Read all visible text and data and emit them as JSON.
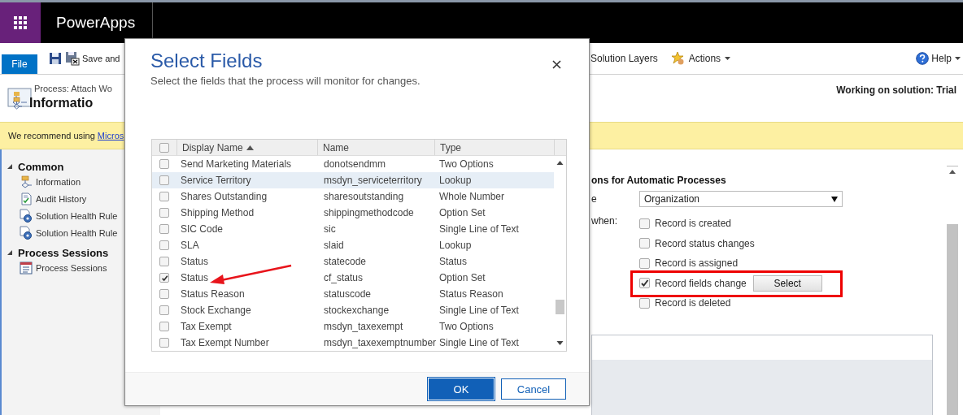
{
  "top_bar": {
    "app_name": "PowerApps"
  },
  "command_bar": {
    "file_tab": "File",
    "left_commands": [
      {
        "kind": "save"
      },
      {
        "kind": "save_close",
        "label": "Save and"
      }
    ],
    "right_commands": [
      {
        "kind": "plain",
        "label": "Solution Layers"
      },
      {
        "kind": "actions",
        "label": "Actions",
        "dropdown": true
      }
    ],
    "help": {
      "label": "Help",
      "dropdown": true
    }
  },
  "header": {
    "subtitle": "Process: Attach Wo",
    "title": "Informatio",
    "solution": "Working on solution: Trial"
  },
  "notice": {
    "text": "We recommend using ",
    "link": "Micros"
  },
  "nav": [
    {
      "label": "Common",
      "expanded": true,
      "items": [
        {
          "kind": "process",
          "label": "Information"
        },
        {
          "kind": "audit",
          "label": "Audit History"
        },
        {
          "kind": "rule",
          "label": "Solution Health Rule"
        },
        {
          "kind": "rule",
          "label": "Solution Health Rule"
        }
      ]
    },
    {
      "label": "Process Sessions",
      "expanded": true,
      "items": [
        {
          "kind": "sessions",
          "label": "Process Sessions"
        }
      ]
    }
  ],
  "automatic": {
    "heading": "ons for Automatic Processes",
    "scope_label": "e",
    "scope_value": "Organization",
    "start_label": "when:",
    "triggers": [
      {
        "label": "Record is created",
        "checked": false,
        "highlighted": false
      },
      {
        "label": "Record status changes",
        "checked": false,
        "highlighted": false
      },
      {
        "label": "Record is assigned",
        "checked": false,
        "highlighted": false
      },
      {
        "label": "Record fields change",
        "checked": true,
        "highlighted": true,
        "button": "Select"
      },
      {
        "label": "Record is deleted",
        "checked": false,
        "highlighted": false
      }
    ]
  },
  "dialog": {
    "title": "Select Fields",
    "subtitle": "Select the fields that the process will monitor for changes.",
    "all_checked": false,
    "columns": [
      {
        "label": "Display Name",
        "sorted_ascending": true
      },
      {
        "label": "Name"
      },
      {
        "label": "Type"
      }
    ],
    "rows": [
      {
        "display_name": "Send Marketing Materials",
        "name": "donotsendmm",
        "type": "Two Options",
        "checked": false,
        "selected": false
      },
      {
        "display_name": "Service Territory",
        "name": "msdyn_serviceterritory",
        "type": "Lookup",
        "checked": false,
        "selected": true
      },
      {
        "display_name": "Shares Outstanding",
        "name": "sharesoutstanding",
        "type": "Whole Number",
        "checked": false,
        "selected": false
      },
      {
        "display_name": "Shipping Method",
        "name": "shippingmethodcode",
        "type": "Option Set",
        "checked": false,
        "selected": false
      },
      {
        "display_name": "SIC Code",
        "name": "sic",
        "type": "Single Line of Text",
        "checked": false,
        "selected": false
      },
      {
        "display_name": "SLA",
        "name": "slaid",
        "type": "Lookup",
        "checked": false,
        "selected": false
      },
      {
        "display_name": "Status",
        "name": "statecode",
        "type": "Status",
        "checked": false,
        "selected": false
      },
      {
        "display_name": "Status",
        "name": "cf_status",
        "type": "Option Set",
        "checked": true,
        "selected": false
      },
      {
        "display_name": "Status Reason",
        "name": "statuscode",
        "type": "Status Reason",
        "checked": false,
        "selected": false
      },
      {
        "display_name": "Stock Exchange",
        "name": "stockexchange",
        "type": "Single Line of Text",
        "checked": false,
        "selected": false
      },
      {
        "display_name": "Tax Exempt",
        "name": "msdyn_taxexempt",
        "type": "Two Options",
        "checked": false,
        "selected": false
      },
      {
        "display_name": "Tax Exempt Number",
        "name": "msdyn_taxexemptnumber",
        "type": "Single Line of Text",
        "checked": false,
        "selected": false
      }
    ],
    "ok": "OK",
    "cancel": "Cancel"
  }
}
